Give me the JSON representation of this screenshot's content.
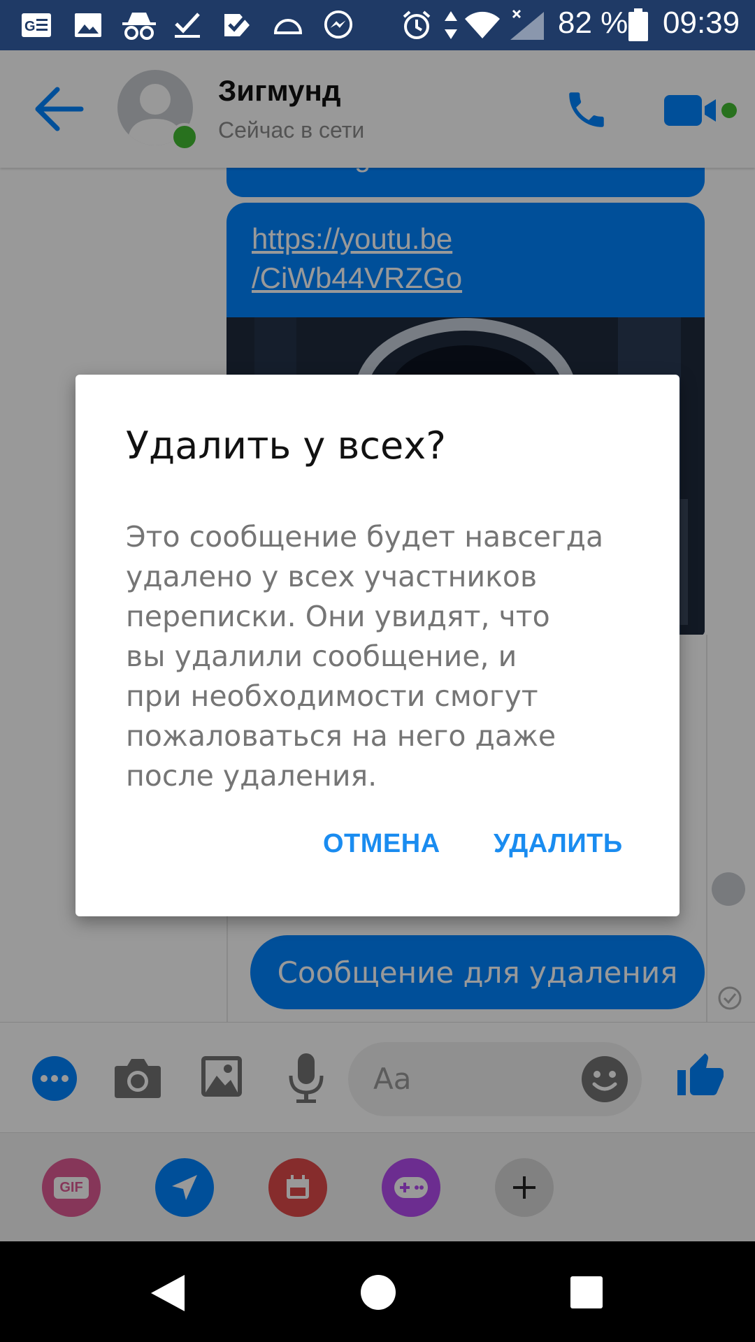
{
  "status_bar": {
    "battery_percent": "82 %",
    "time": "09:39",
    "icons": [
      "news-icon",
      "gallery-icon",
      "incognito-icon",
      "check-icon",
      "check-list-icon",
      "cloud-icon",
      "messenger-icon",
      "alarm-icon",
      "data-arrows-icon",
      "wifi-icon",
      "signal-icon",
      "battery-icon"
    ]
  },
  "header": {
    "contact_name": "Зигмунд",
    "status": "Сейчас в сети",
    "accent_color": "#0084ff",
    "online_color": "#44bd32"
  },
  "chat": {
    "partial_message": "Messenger",
    "link_line1": "https://youtu.be",
    "link_line2": "/CiWb44VRZGo",
    "pending_message": "Сообщение для удаления"
  },
  "composer": {
    "placeholder": "Aa"
  },
  "extras": {
    "gif_label": "GIF"
  },
  "dialog": {
    "title": "Удалить у всех?",
    "body": "Это сообщение будет навсегда\nудалено у всех участников\nпереписки. Они увидят, что\nвы удалили сообщение, и\nпри необходимости смогут\nпожаловаться на него даже\nпосле удаления.",
    "cancel_label": "ОТМЕНА",
    "delete_label": "УДАЛИТЬ"
  }
}
